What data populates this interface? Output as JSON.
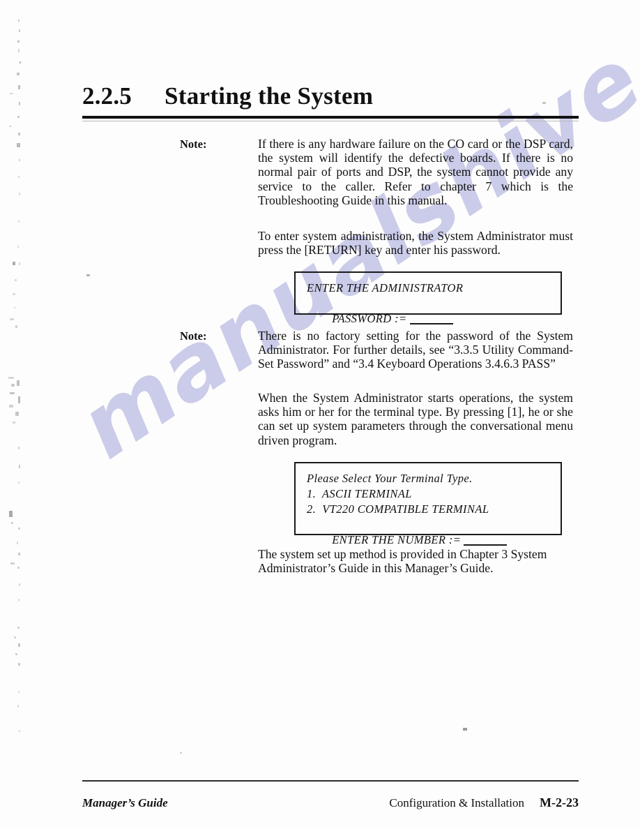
{
  "document": {
    "section_number": "2.2.5",
    "section_title": "Starting the System"
  },
  "blocks": {
    "note1_label": "Note:",
    "note1_text": "If there is any hardware failure on the CO card or the DSP card, the system will identify the defective boards. If there is no normal pair of ports and DSP, the system cannot provide any service to the caller. Refer to chapter 7 which is the Troubleshooting Guide in this manual.",
    "para_enter_admin": "To enter system administration, the System Administrator must press the [RETURN] key and enter his password.",
    "note2_label": "Note:",
    "note2_text": "There is no factory setting for the password of the System Administrator. For further details, see “3.3.5 Utility Command-Set Password” and “3.4 Keyboard Operations 3.4.6.3 PASS”",
    "para_terminal_type": "When the System Administrator starts operations, the system asks him or her for the terminal type. By pressing [1], he or she can set up system parameters through the conversational menu driven program.",
    "para_setup_method": "The system set up method is provided in Chapter 3 System Administrator’s Guide in this Manager’s Guide."
  },
  "terminal_box_1": {
    "line1": "ENTER THE ADMINISTRATOR",
    "line2_label": "PASSWORD :="
  },
  "terminal_box_2": {
    "line1": "Please Select Your Terminal Type.",
    "line2": "1.  ASCII TERMINAL",
    "line3": "2.  VT220 COMPATIBLE TERMINAL",
    "line4_label": "ENTER THE NUMBER :="
  },
  "footer": {
    "left": "Manager’s Guide",
    "center_right": "Configuration & Installation",
    "page_number": "M-2-23"
  },
  "watermark": {
    "text": "manualshive.com",
    "color": "#c3c4e6"
  }
}
